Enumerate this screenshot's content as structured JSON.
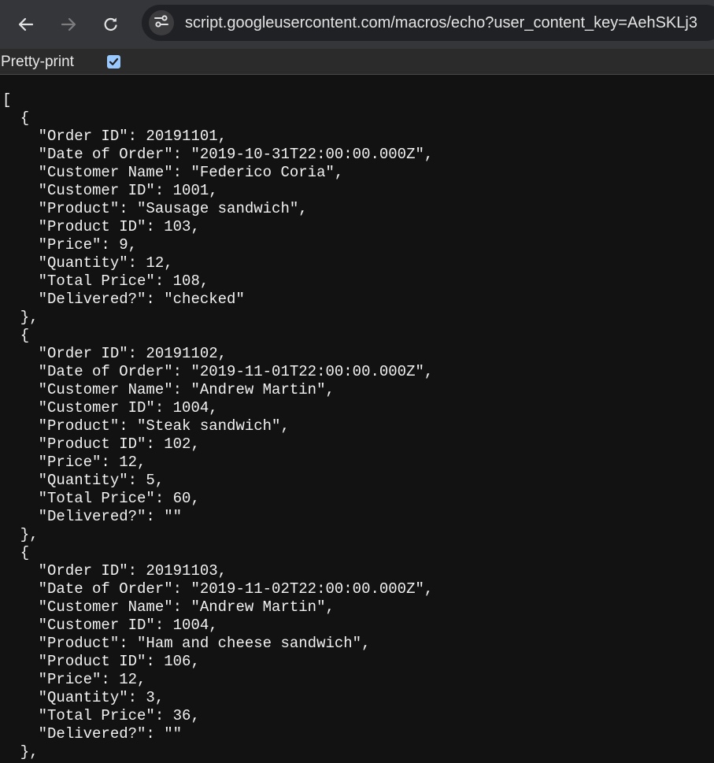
{
  "browser": {
    "url": "script.googleusercontent.com/macros/echo?user_content_key=AehSKLj3",
    "back_icon": "arrow-left-icon",
    "forward_icon": "arrow-right-icon",
    "reload_icon": "reload-icon",
    "site_info_icon": "tune-icon"
  },
  "pretty_print": {
    "label": "Pretty-print",
    "checked": true
  },
  "json_lines": [
    "[",
    "  {",
    "    \"Order ID\": 20191101,",
    "    \"Date of Order\": \"2019-10-31T22:00:00.000Z\",",
    "    \"Customer Name\": \"Federico Coria\",",
    "    \"Customer ID\": 1001,",
    "    \"Product\": \"Sausage sandwich\",",
    "    \"Product ID\": 103,",
    "    \"Price\": 9,",
    "    \"Quantity\": 12,",
    "    \"Total Price\": 108,",
    "    \"Delivered?\": \"checked\"",
    "  },",
    "  {",
    "    \"Order ID\": 20191102,",
    "    \"Date of Order\": \"2019-11-01T22:00:00.000Z\",",
    "    \"Customer Name\": \"Andrew Martin\",",
    "    \"Customer ID\": 1004,",
    "    \"Product\": \"Steak sandwich\",",
    "    \"Product ID\": 102,",
    "    \"Price\": 12,",
    "    \"Quantity\": 5,",
    "    \"Total Price\": 60,",
    "    \"Delivered?\": \"\"",
    "  },",
    "  {",
    "    \"Order ID\": 20191103,",
    "    \"Date of Order\": \"2019-11-02T22:00:00.000Z\",",
    "    \"Customer Name\": \"Andrew Martin\",",
    "    \"Customer ID\": 1004,",
    "    \"Product\": \"Ham and cheese sandwich\",",
    "    \"Product ID\": 106,",
    "    \"Price\": 12,",
    "    \"Quantity\": 3,",
    "    \"Total Price\": 36,",
    "    \"Delivered?\": \"\"",
    "  },"
  ]
}
